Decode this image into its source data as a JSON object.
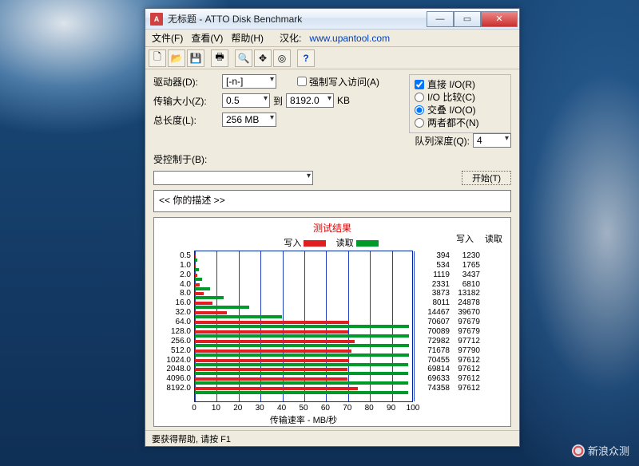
{
  "window": {
    "title": "无标题 - ATTO Disk Benchmark"
  },
  "menu": {
    "file": "文件(F)",
    "view": "查看(V)",
    "help": "帮助(H)",
    "locale": "汉化:",
    "url": "www.upantool.com"
  },
  "labels": {
    "drive": "驱动器(D):",
    "drive_val": "[-n-]",
    "xfer": "传输大小(Z):",
    "xfer_from": "0.5",
    "to": "到",
    "xfer_to": "8192.0",
    "kb": "KB",
    "length": "总长度(L):",
    "length_val": "256 MB",
    "force": "强制写入访问(A)",
    "direct": "直接 I/O(R)",
    "ioComp": "I/O 比较(C)",
    "overlap": "交叠 I/O(O)",
    "neither": "两者都不(N)",
    "queue": "队列深度(Q):",
    "queue_val": "4",
    "controlled": "受控制于(B):",
    "start": "开始(T)",
    "desc": "<<  你的描述   >>",
    "results": "测试结果",
    "write": "写入",
    "read": "读取",
    "xlabel": "传输速率 - MB/秒",
    "status": "要获得帮助, 请按 F1"
  },
  "watermark": "新浪众测",
  "chart_data": {
    "type": "bar",
    "xlabel": "传输速率 - MB/秒",
    "xlim": [
      0,
      100
    ],
    "xticks": [
      0,
      10,
      20,
      30,
      40,
      50,
      60,
      70,
      80,
      90,
      100
    ],
    "categories": [
      "0.5",
      "1.0",
      "2.0",
      "4.0",
      "8.0",
      "16.0",
      "32.0",
      "64.0",
      "128.0",
      "256.0",
      "512.0",
      "1024.0",
      "2048.0",
      "4096.0",
      "8192.0"
    ],
    "series": [
      {
        "name": "写入",
        "color": "#e02020",
        "values": [
          0.394,
          0.534,
          1.119,
          2.331,
          3.873,
          8.011,
          14.467,
          70.607,
          70.089,
          72.982,
          71.678,
          70.455,
          69.814,
          69.633,
          74.358
        ]
      },
      {
        "name": "读取",
        "color": "#009a2a",
        "values": [
          1.23,
          1.765,
          3.437,
          6.81,
          13.182,
          24.878,
          39.67,
          97.679,
          97.679,
          97.712,
          97.79,
          97.612,
          97.612,
          97.612,
          97.612
        ]
      }
    ],
    "value_table": [
      [
        394,
        1230
      ],
      [
        534,
        1765
      ],
      [
        1119,
        3437
      ],
      [
        2331,
        6810
      ],
      [
        3873,
        13182
      ],
      [
        8011,
        24878
      ],
      [
        14467,
        39670
      ],
      [
        70607,
        97679
      ],
      [
        70089,
        97679
      ],
      [
        72982,
        97712
      ],
      [
        71678,
        97790
      ],
      [
        70455,
        97612
      ],
      [
        69814,
        97612
      ],
      [
        69633,
        97612
      ],
      [
        74358,
        97612
      ]
    ]
  }
}
